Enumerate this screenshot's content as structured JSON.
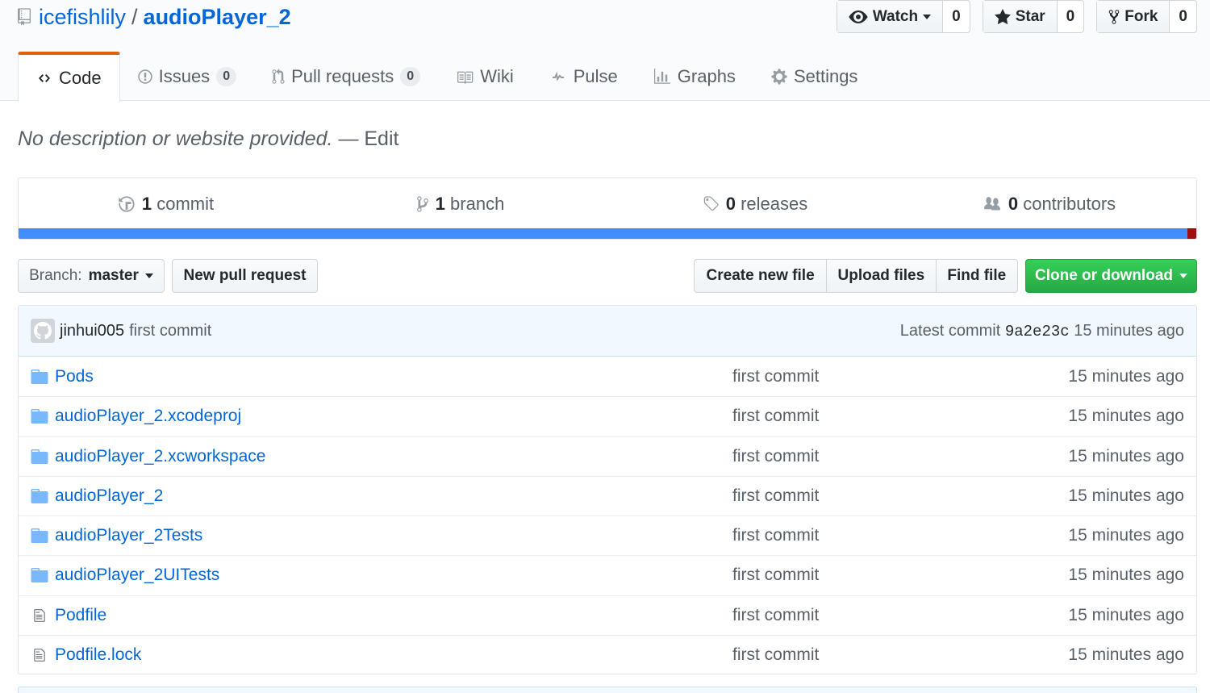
{
  "repo": {
    "owner": "icefishlily",
    "separator": "/",
    "name": "audioPlayer_2"
  },
  "actions": {
    "watch": {
      "label": "Watch",
      "count": "0"
    },
    "star": {
      "label": "Star",
      "count": "0"
    },
    "fork": {
      "label": "Fork",
      "count": "0"
    }
  },
  "tabs": [
    {
      "label": "Code",
      "icon": "code-icon",
      "selected": true
    },
    {
      "label": "Issues",
      "counter": "0",
      "icon": "issue-icon"
    },
    {
      "label": "Pull requests",
      "counter": "0",
      "icon": "pull-request-icon"
    },
    {
      "label": "Wiki",
      "icon": "book-icon"
    },
    {
      "label": "Pulse",
      "icon": "pulse-icon"
    },
    {
      "label": "Graphs",
      "icon": "graph-icon"
    },
    {
      "label": "Settings",
      "icon": "gear-icon"
    }
  ],
  "description": {
    "text": "No description or website provided.",
    "edit": "— Edit"
  },
  "summary": {
    "commits": {
      "num": "1",
      "label": "commit"
    },
    "branches": {
      "num": "1",
      "label": "branch"
    },
    "releases": {
      "num": "0",
      "label": "releases"
    },
    "contributors": {
      "num": "0",
      "label": "contributors"
    }
  },
  "toolbar": {
    "branch_prefix": "Branch:",
    "branch_name": "master",
    "new_pr": "New pull request",
    "create_file": "Create new file",
    "upload_files": "Upload files",
    "find_file": "Find file",
    "clone": "Clone or download"
  },
  "commit_bar": {
    "author": "jinhui005",
    "message": "first commit",
    "latest_prefix": "Latest commit",
    "sha": "9a2e23c",
    "age": "15 minutes ago"
  },
  "files": [
    {
      "name": "Pods",
      "type": "folder",
      "message": "first commit",
      "age": "15 minutes ago"
    },
    {
      "name": "audioPlayer_2.xcodeproj",
      "type": "folder",
      "message": "first commit",
      "age": "15 minutes ago"
    },
    {
      "name": "audioPlayer_2.xcworkspace",
      "type": "folder",
      "message": "first commit",
      "age": "15 minutes ago"
    },
    {
      "name": "audioPlayer_2",
      "type": "folder",
      "message": "first commit",
      "age": "15 minutes ago"
    },
    {
      "name": "audioPlayer_2Tests",
      "type": "folder",
      "message": "first commit",
      "age": "15 minutes ago"
    },
    {
      "name": "audioPlayer_2UITests",
      "type": "folder",
      "message": "first commit",
      "age": "15 minutes ago"
    },
    {
      "name": "Podfile",
      "type": "file",
      "message": "first commit",
      "age": "15 minutes ago"
    },
    {
      "name": "Podfile.lock",
      "type": "file",
      "message": "first commit",
      "age": "15 minutes ago"
    }
  ],
  "colors": {
    "link": "#0366d6",
    "accent_tab": "#e36209",
    "lang_primary": "#438eff",
    "lang_secondary": "#a00f0f",
    "clone_green": "#28a745",
    "commit_bar_bg": "#f1f8ff"
  }
}
